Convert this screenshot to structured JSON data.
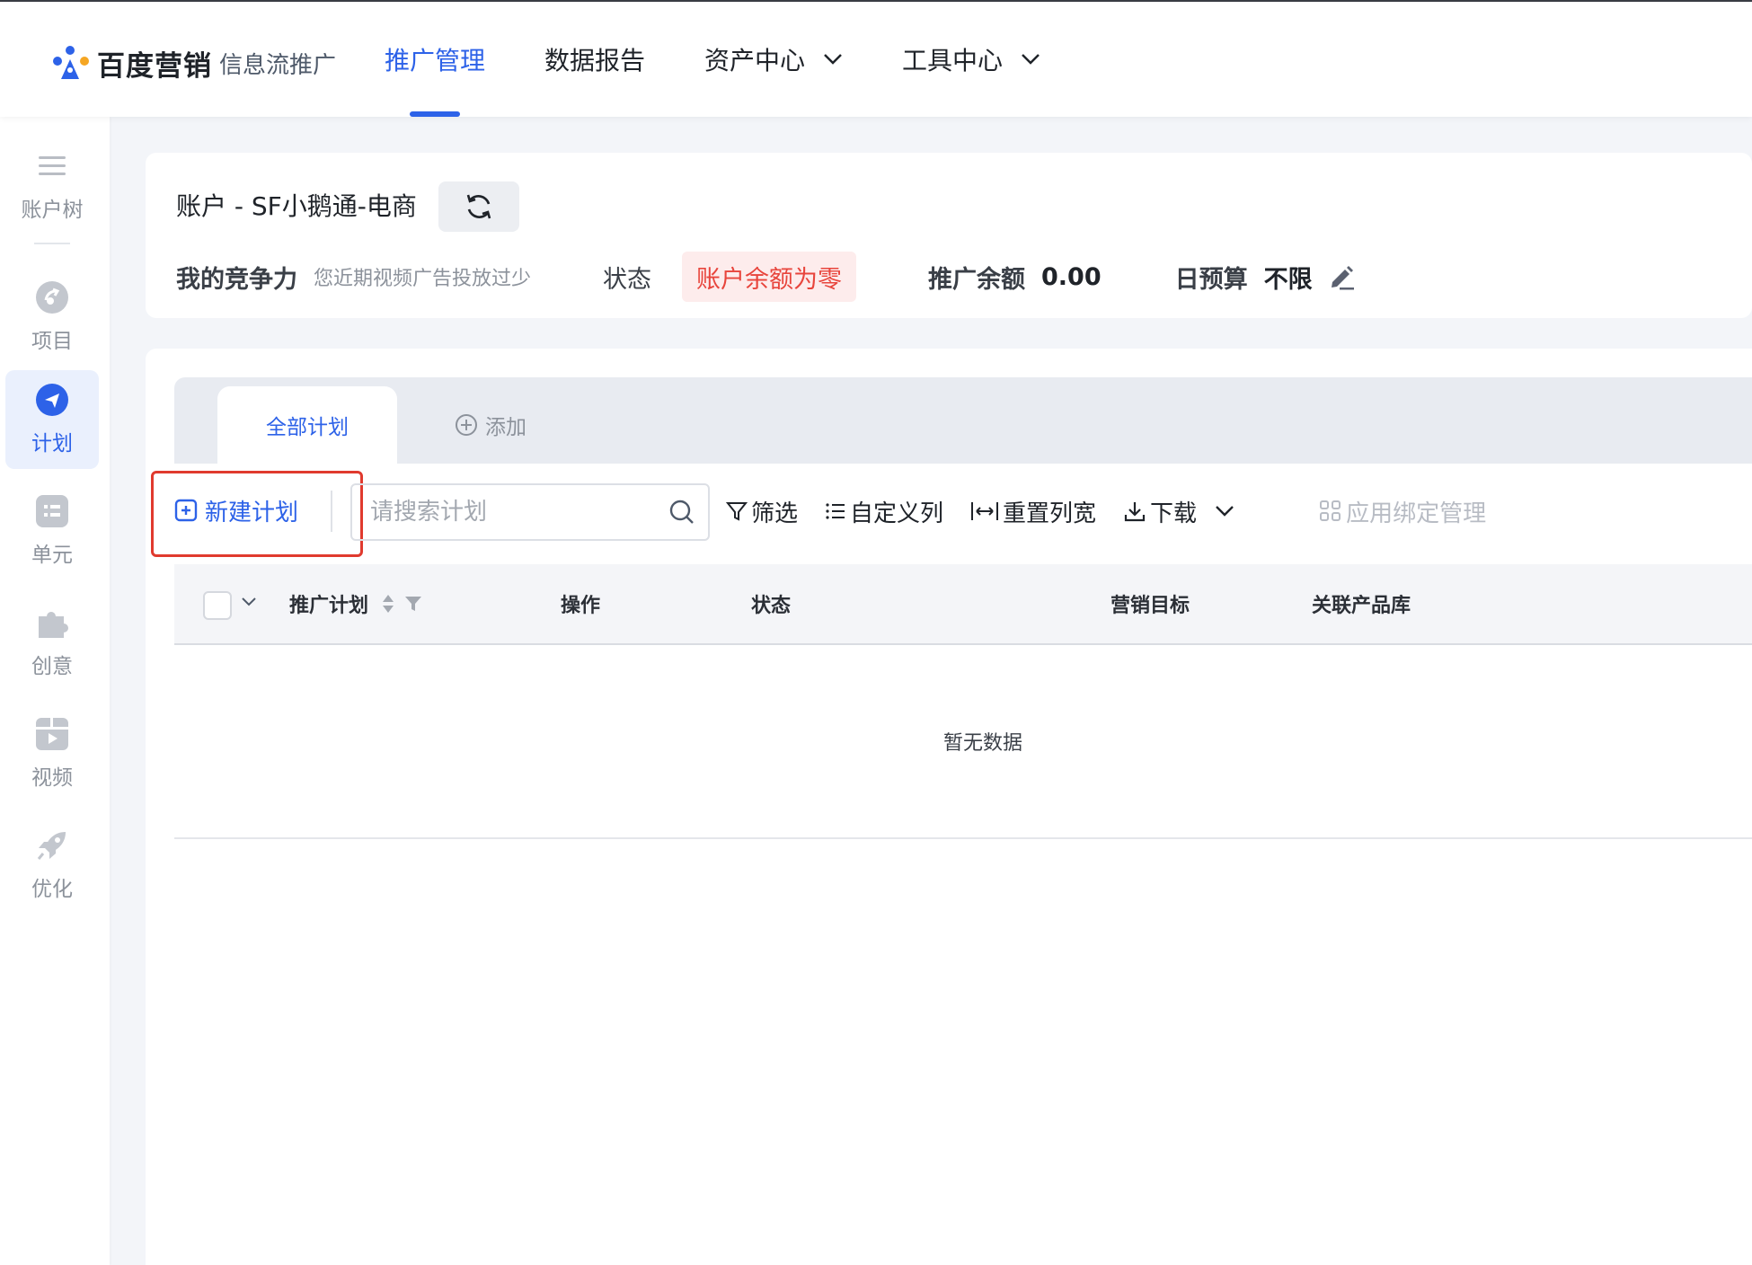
{
  "header": {
    "brand": "百度营销",
    "product": "信息流推广",
    "nav": [
      {
        "label": "推广管理",
        "active": true
      },
      {
        "label": "数据报告"
      },
      {
        "label": "资产中心",
        "dropdown": true
      },
      {
        "label": "工具中心",
        "dropdown": true
      }
    ]
  },
  "sidebar": {
    "items": [
      {
        "label": "账户树",
        "icon": "menu-icon"
      },
      {
        "label": "项目",
        "icon": "project-icon"
      },
      {
        "label": "计划",
        "icon": "plan-icon",
        "active": true
      },
      {
        "label": "单元",
        "icon": "unit-icon"
      },
      {
        "label": "创意",
        "icon": "puzzle-icon"
      },
      {
        "label": "视频",
        "icon": "video-icon"
      },
      {
        "label": "优化",
        "icon": "rocket-icon"
      }
    ]
  },
  "account": {
    "name": "账户 - SF小鹅通-电商",
    "competitiveness_label": "我的竞争力",
    "competitiveness_hint": "您近期视频广告投放过少",
    "status_label": "状态",
    "status_value": "账户余额为零",
    "balance_label": "推广余额",
    "balance_value": "0.00",
    "budget_label": "日预算",
    "budget_value": "不限"
  },
  "tabs": {
    "active": "全部计划",
    "add": "添加"
  },
  "toolbar": {
    "new_plan": "新建计划",
    "search_placeholder": "请搜索计划",
    "filter": "筛选",
    "custom_columns": "自定义列",
    "reset_width": "重置列宽",
    "download": "下载",
    "app_binding": "应用绑定管理"
  },
  "table": {
    "columns": [
      "推广计划",
      "操作",
      "状态",
      "营销目标",
      "关联产品库"
    ],
    "empty_text": "暂无数据"
  },
  "colors": {
    "primary": "#2d62e8",
    "danger": "#e8453c",
    "highlight_box": "#e03a2e"
  }
}
